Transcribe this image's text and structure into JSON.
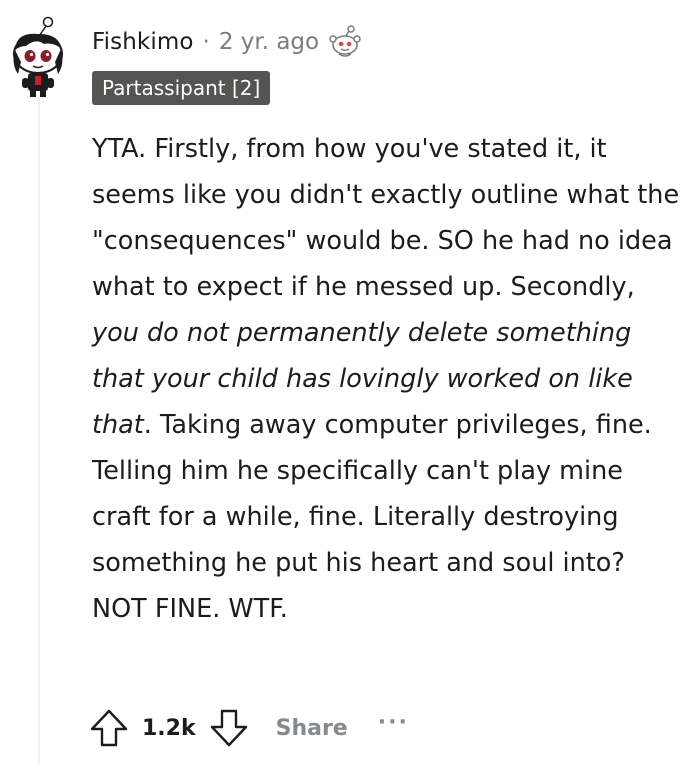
{
  "comment": {
    "username": "Fishkimo",
    "separator": "·",
    "timestamp": "2 yr. ago",
    "flair": "Partassipant [2]",
    "body": {
      "p1": "YTA. Firstly, from how you've stated it, it seems like you didn't exactly outline what the \"consequences\" would be. SO he had no idea what to expect if he messed up. Secondly, ",
      "emphasis": "you do not permanently delete something that your child has lovingly worked on like that",
      "p2": ". Taking away computer privileges, fine. Telling him he specifically can't play mine craft for a while, fine. Literally destroying something he put his heart and soul into? NOT FINE. WTF."
    }
  },
  "actions": {
    "score": "1.2k",
    "share_label": "Share",
    "more_label": "···"
  },
  "icons": {
    "avatar": "avatar",
    "award": "snoo-award-icon",
    "upvote": "upvote-arrow-icon",
    "downvote": "downvote-arrow-icon",
    "more": "more-options-icon"
  },
  "colors": {
    "text": "#1c1c1c",
    "meta": "#7c7c7c",
    "flair_bg": "#545452",
    "flair_text": "#ffffff",
    "thread_line": "#edeff1",
    "muted": "#878a8c"
  }
}
